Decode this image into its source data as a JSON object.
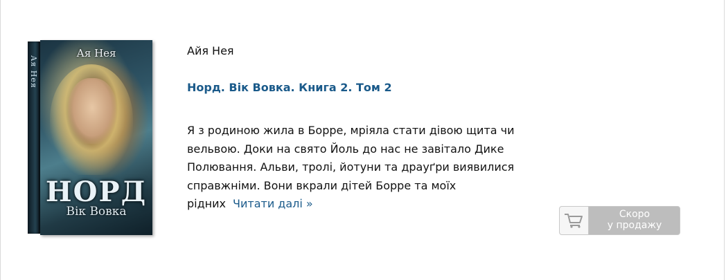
{
  "book": {
    "cover": {
      "spine_text": "Ая Нея",
      "author_text": "Ая Нея",
      "title_text": "НОРД",
      "subtitle_text": "Вік Вовка"
    },
    "author": "Айя Нея",
    "title": "Норд. Вік Вовка. Книга 2. Том 2",
    "description": "Я з родиною жила в Борре, мріяла стати дівою щита чи вельвою. Доки на свято Йоль до нас не завітало Дике Полювання. Альви, тролі, йотуни та драуґри виявилися справжніми. Вони вкрали дітей Борре та моїх рідних",
    "read_more": "Читати далі »"
  },
  "button": {
    "line1": "Скоро",
    "line2": "у продажу",
    "icon": "cart-icon"
  },
  "colors": {
    "link": "#1a5a8a",
    "button_bg": "#bdbdbd"
  }
}
